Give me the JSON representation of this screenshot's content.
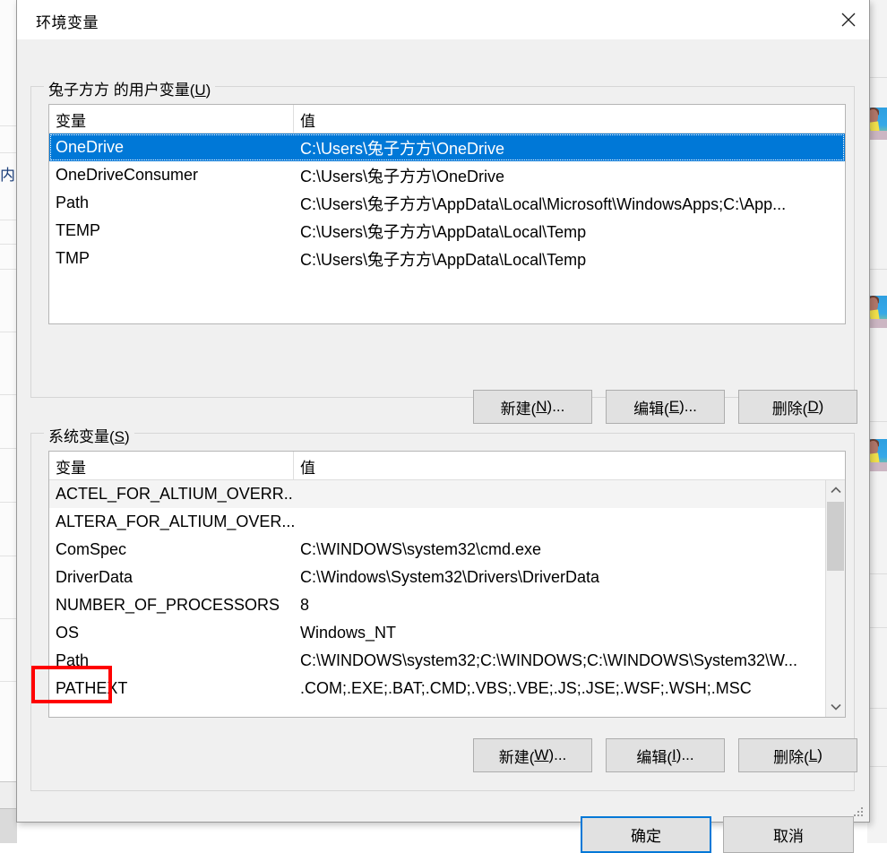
{
  "window": {
    "title": "环境变量",
    "close_icon": "close-icon"
  },
  "user_section": {
    "label_prefix": "兔子方方 的用户变量(",
    "label_accel": "U",
    "label_suffix": ")",
    "columns": [
      "变量",
      "值"
    ],
    "rows": [
      {
        "name": "OneDrive",
        "value": "C:\\Users\\兔子方方\\OneDrive",
        "selected": true
      },
      {
        "name": "OneDriveConsumer",
        "value": "C:\\Users\\兔子方方\\OneDrive",
        "selected": false
      },
      {
        "name": "Path",
        "value": "C:\\Users\\兔子方方\\AppData\\Local\\Microsoft\\WindowsApps;C:\\App...",
        "selected": false
      },
      {
        "name": "TEMP",
        "value": "C:\\Users\\兔子方方\\AppData\\Local\\Temp",
        "selected": false
      },
      {
        "name": "TMP",
        "value": "C:\\Users\\兔子方方\\AppData\\Local\\Temp",
        "selected": false
      }
    ],
    "buttons": {
      "new": {
        "prefix": "新建(",
        "accel": "N",
        "suffix": ")..."
      },
      "edit": {
        "prefix": "编辑(",
        "accel": "E",
        "suffix": ")..."
      },
      "delete": {
        "prefix": "删除(",
        "accel": "D",
        "suffix": ")"
      }
    }
  },
  "system_section": {
    "label_prefix": "系统变量(",
    "label_accel": "S",
    "label_suffix": ")",
    "columns": [
      "变量",
      "值"
    ],
    "rows": [
      {
        "name": "ACTEL_FOR_ALTIUM_OVERR...",
        "value": ""
      },
      {
        "name": "ALTERA_FOR_ALTIUM_OVER...",
        "value": ""
      },
      {
        "name": "ComSpec",
        "value": "C:\\WINDOWS\\system32\\cmd.exe"
      },
      {
        "name": "DriverData",
        "value": "C:\\Windows\\System32\\Drivers\\DriverData"
      },
      {
        "name": "NUMBER_OF_PROCESSORS",
        "value": "8"
      },
      {
        "name": "OS",
        "value": "Windows_NT"
      },
      {
        "name": "Path",
        "value": "C:\\WINDOWS\\system32;C:\\WINDOWS;C:\\WINDOWS\\System32\\W..."
      },
      {
        "name": "PATHEXT",
        "value": ".COM;.EXE;.BAT;.CMD;.VBS;.VBE;.JS;.JSE;.WSF;.WSH;.MSC"
      }
    ],
    "buttons": {
      "new": {
        "prefix": "新建(",
        "accel": "W",
        "suffix": ")..."
      },
      "edit": {
        "prefix": "编辑(",
        "accel": "I",
        "suffix": ")..."
      },
      "delete": {
        "prefix": "删除(",
        "accel": "L",
        "suffix": ")"
      }
    },
    "scrollbar": {
      "up_icon": "chevron-up-icon",
      "down_icon": "chevron-down-icon"
    }
  },
  "footer": {
    "ok": "确定",
    "cancel": "取消"
  },
  "annotation": {
    "target": "Path",
    "color": "#ff0000"
  },
  "background": {
    "left_glyph": "内"
  },
  "colors": {
    "selection": "#0078d7",
    "dialog_bg": "#f0f0f0",
    "titlebar_bg": "#ffffff",
    "button_bg": "#e1e1e1",
    "annotation_red": "#ff0000"
  }
}
